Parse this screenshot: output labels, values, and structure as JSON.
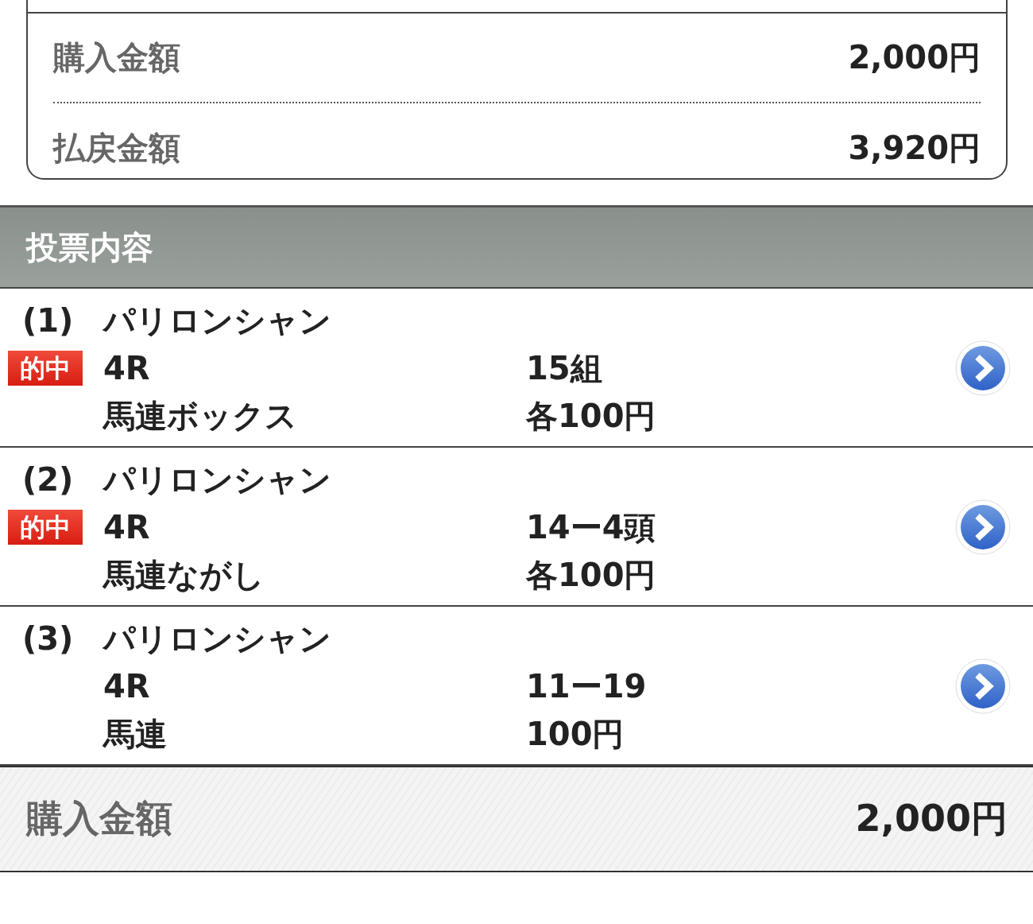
{
  "summary": [
    {
      "label": "購入金額",
      "value": "2,000円"
    },
    {
      "label": "払戻金額",
      "value": "3,920円"
    }
  ],
  "section": {
    "title": "投票内容"
  },
  "bets": [
    {
      "number": "(1)",
      "race_name": "パリロンシャン",
      "badge": "的中",
      "race": "4R",
      "bet_type": "馬連ボックス",
      "combination": "15組",
      "amount": "各100円"
    },
    {
      "number": "(2)",
      "race_name": "パリロンシャン",
      "badge": "的中",
      "race": "4R",
      "bet_type": "馬連ながし",
      "combination": "14ー4頭",
      "amount": "各100円"
    },
    {
      "number": "(3)",
      "race_name": "パリロンシャン",
      "race": "4R",
      "bet_type": "馬連",
      "combination": "11ー19",
      "amount": "100円"
    }
  ],
  "footer": {
    "label": "購入金額",
    "value": "2,000円"
  }
}
